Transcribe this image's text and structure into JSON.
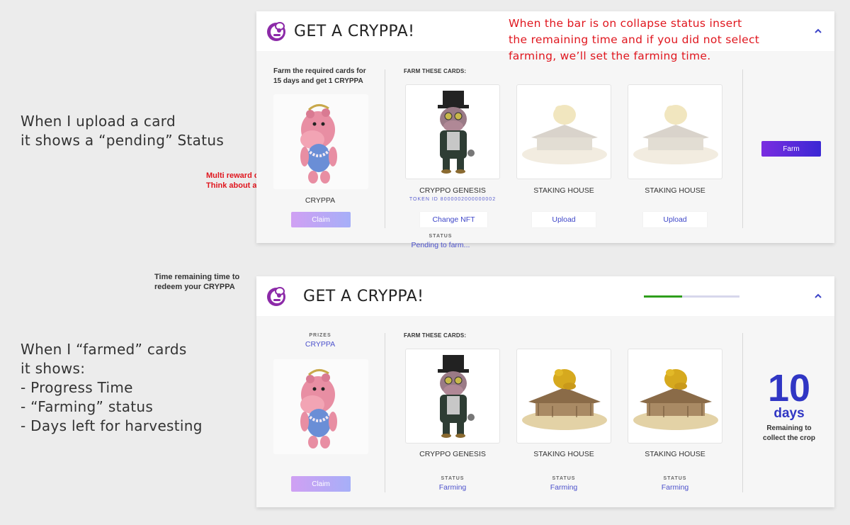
{
  "notes": {
    "upload_line1": "When I upload a card",
    "upload_line2": "it shows a “pending” Status",
    "collapse_line1": "When the bar is on collapse status insert",
    "collapse_line2": "the remaining time and if you did not select",
    "collapse_line3": "farming, we’ll set the farming time.",
    "multi_line1": "Multi reward case",
    "multi_line2": "Think about a slider",
    "time_line1": "Time remaining time to",
    "time_line2": "redeem your CRYPPA",
    "farmed_line1": "When I “farmed” cards",
    "farmed_line2": "it shows:",
    "farmed_line3": "- Progress Time",
    "farmed_line4": "- “Farming” status",
    "farmed_line5": "- Days left for harvesting"
  },
  "panel1": {
    "title": "GET A CRYPPA!",
    "desc_line1": "Farm the required cards for",
    "desc_line2": "15 days and get 1 CRYPPA",
    "reward_name": "CRYPPA",
    "claim_label": "Claim",
    "farm_these": "FARM THESE CARDS:",
    "cards": [
      {
        "name": "CRYPPO GENESIS",
        "token_label": "TOKEN ID",
        "token_id": "8000002000000002",
        "button": "Change NFT"
      },
      {
        "name": "STAKING HOUSE",
        "button": "Upload"
      },
      {
        "name": "STAKING HOUSE",
        "button": "Upload"
      }
    ],
    "status_label": "STATUS",
    "status_value": "Pending to farm...",
    "farm_button": "Farm"
  },
  "panel2": {
    "title": "GET A CRYPPA!",
    "progress": 0.4,
    "prizes_label": "PRIZES",
    "prize_name": "CRYPPA",
    "claim_label": "Claim",
    "farm_these": "FARM THESE CARDS:",
    "cards": [
      {
        "name": "CRYPPO GENESIS",
        "status_label": "STATUS",
        "status": "Farming"
      },
      {
        "name": "STAKING HOUSE",
        "status_label": "STATUS",
        "status": "Farming"
      },
      {
        "name": "STAKING HOUSE",
        "status_label": "STATUS",
        "status": "Farming"
      }
    ],
    "days_number": "10",
    "days_unit": "days",
    "days_desc_line1": "Remaining to",
    "days_desc_line2": "collect the crop"
  },
  "colors": {
    "accent": "#3d45c8",
    "annotation_red": "#e0161e",
    "progress_green": "#2f9e1c",
    "brand_purple": "#7a2de0"
  },
  "icons": {
    "logo": "cryppa-logo-icon",
    "collapse": "chevron-up-icon"
  }
}
